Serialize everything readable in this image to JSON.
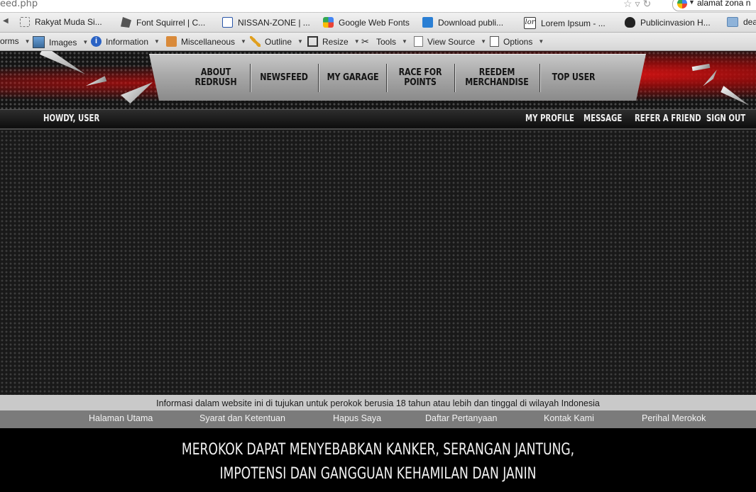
{
  "browser": {
    "url": "eed.php",
    "search_text": "alamat zona n"
  },
  "bookmarks": [
    {
      "label": "Rakyat Muda Si...",
      "icon": "dashed-box-icon"
    },
    {
      "label": "Font Squirrel | C...",
      "icon": "squirrel-icon"
    },
    {
      "label": "NISSAN-ZONE | ...",
      "icon": "nissan-zone-icon"
    },
    {
      "label": "Google Web Fonts",
      "icon": "google-icon"
    },
    {
      "label": "Download publi...",
      "icon": "download-icon"
    },
    {
      "label": "Lorem Ipsum - ...",
      "icon": "lorem-icon"
    },
    {
      "label": "Publicinvasion H...",
      "icon": "skull-icon"
    },
    {
      "label": "dea",
      "icon": "folder-icon"
    }
  ],
  "devtoolbar": {
    "forms": "orms",
    "images": "Images",
    "information": "Information",
    "miscellaneous": "Miscellaneous",
    "outline": "Outline",
    "resize": "Resize",
    "tools": "Tools",
    "view_source": "View Source",
    "options": "Options"
  },
  "nav": {
    "about": [
      "ABOUT",
      "REDRUSH"
    ],
    "newsfeed": "NEWSFEED",
    "garage": "MY GARAGE",
    "race": [
      "RACE FOR",
      "POINTS"
    ],
    "redeem": [
      "REEDEM",
      "MERCHANDISE"
    ],
    "top_user": "TOP USER"
  },
  "userbar": {
    "greeting": "HOWDY, USER",
    "profile": "MY PROFILE",
    "message": "MESSAGE",
    "refer": "REFER A FRIEND",
    "signout": "SIGN OUT"
  },
  "footer": {
    "disclaimer": "Informasi dalam website ini di tujukan untuk perokok berusia 18 tahun atau lebih dan tinggal di wilayah Indonesia",
    "links": [
      "Halaman Utama",
      "Syarat dan Ketentuan",
      "Hapus Saya",
      "Daftar Pertanyaan",
      "Kontak Kami",
      "Perihal Merokok"
    ],
    "warning_line1": "MEROKOK DAPAT MENYEBABKAN KANKER, SERANGAN JANTUNG,",
    "warning_line2": "IMPOTENSI DAN GANGGUAN KEHAMILAN DAN JANIN"
  }
}
